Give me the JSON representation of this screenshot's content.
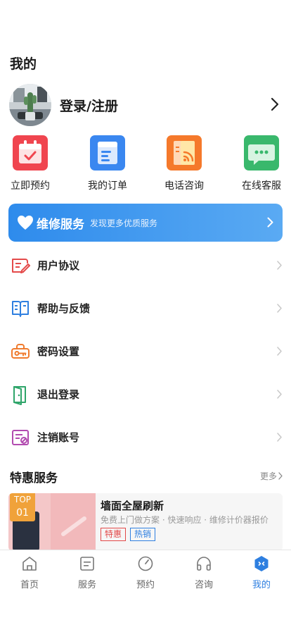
{
  "header": {
    "title": "我的"
  },
  "profile": {
    "login_label": "登录/注册"
  },
  "quick_actions": [
    {
      "label": "立即预约",
      "icon": "calendar-icon",
      "color": "#f0454f"
    },
    {
      "label": "我的订单",
      "icon": "order-list-icon",
      "color": "#3a87f0"
    },
    {
      "label": "电话咨询",
      "icon": "phone-consult-icon",
      "color": "#f5792b"
    },
    {
      "label": "在线客服",
      "icon": "chat-icon",
      "color": "#39b86c"
    }
  ],
  "banner": {
    "title": "维修服务",
    "subtitle": "发现更多优质服务",
    "color": "#3a94ee"
  },
  "menu": [
    {
      "label": "用户协议",
      "icon": "agreement-icon"
    },
    {
      "label": "帮助与反馈",
      "icon": "help-book-icon"
    },
    {
      "label": "密码设置",
      "icon": "key-icon"
    },
    {
      "label": "退出登录",
      "icon": "logout-door-icon"
    },
    {
      "label": "注销账号",
      "icon": "cancel-account-icon"
    }
  ],
  "special": {
    "title": "特惠服务",
    "more": "更多",
    "items": [
      {
        "badge_top": "TOP",
        "badge_num": "01",
        "title": "墙面全屋刷新",
        "desc": "免费上门做方案 · 快速响应 · 维修计价器报价",
        "tags": [
          "特惠",
          "热销"
        ]
      }
    ]
  },
  "tabbar": {
    "items": [
      {
        "label": "首页",
        "icon": "home-icon"
      },
      {
        "label": "服务",
        "icon": "service-icon"
      },
      {
        "label": "预约",
        "icon": "booking-dial-icon"
      },
      {
        "label": "咨询",
        "icon": "headphones-icon"
      },
      {
        "label": "我的",
        "icon": "profile-hex-icon",
        "active": true
      }
    ],
    "active_color": "#2e7fe0"
  }
}
